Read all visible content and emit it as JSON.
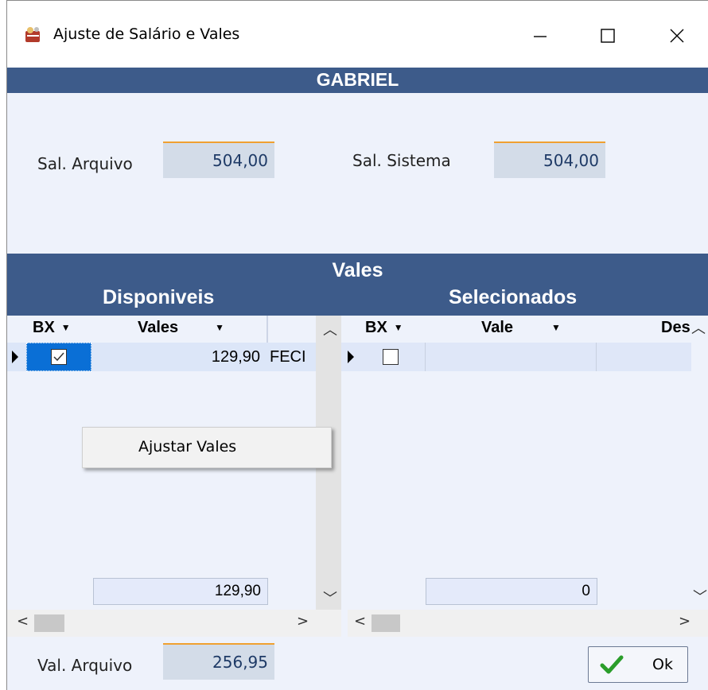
{
  "window": {
    "title": "Ajuste de Salário e Vales",
    "employee_name": "GABRIEL"
  },
  "salary": {
    "file_label": "Sal. Arquivo",
    "file_value": "504,00",
    "system_label": "Sal. Sistema",
    "system_value": "504,00"
  },
  "vales_section": {
    "title": "Vales",
    "available_title": "Disponiveis",
    "selected_title": "Selecionados"
  },
  "available_grid": {
    "columns": [
      "BX",
      "Vales"
    ],
    "rows": [
      {
        "checked": true,
        "value": "129,90",
        "desc": "FECI"
      }
    ],
    "total": "129,90"
  },
  "selected_grid": {
    "columns": [
      "BX",
      "Vale",
      "Des"
    ],
    "rows": [
      {
        "checked": false,
        "value": "",
        "desc": ""
      }
    ],
    "total": "0"
  },
  "context_menu": {
    "items": [
      "Ajustar Vales"
    ]
  },
  "footer": {
    "file_value_label": "Val. Arquivo",
    "file_value": "256,95",
    "ok_label": "Ok"
  },
  "colors": {
    "band": "#3d5b8a",
    "background": "#eef2fb",
    "accent": "#f0a030",
    "check_green": "#2a9d2a"
  },
  "icons": [
    "app-icon",
    "minimize-icon",
    "maximize-icon",
    "close-icon",
    "chevron-down-icon",
    "row-pointer-icon",
    "checkmark-icon",
    "arrow-up-icon",
    "arrow-down-icon",
    "arrow-left-icon",
    "arrow-right-icon"
  ]
}
